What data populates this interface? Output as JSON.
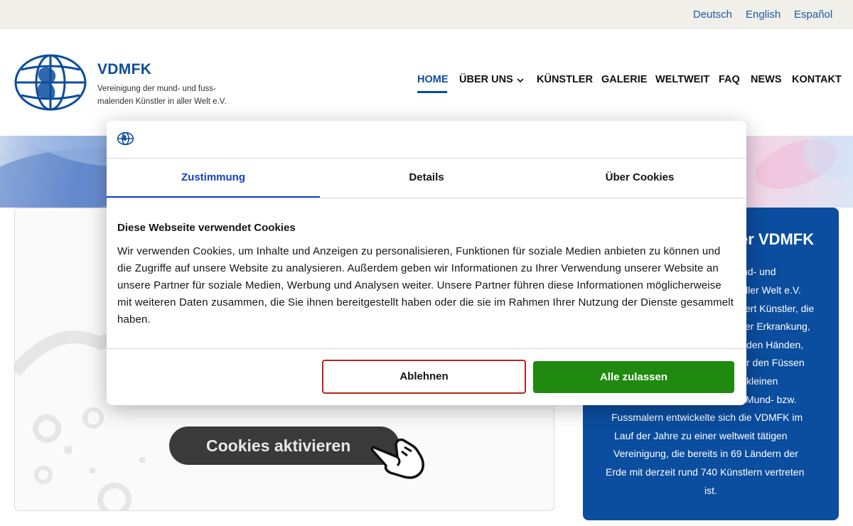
{
  "languages": [
    "Deutsch",
    "English",
    "Español"
  ],
  "brand": {
    "name": "VDMFK",
    "tagline_line1": "Vereinigung der mund- und fuss-",
    "tagline_line2": "malenden Künstler in aller Welt e.V."
  },
  "nav": {
    "items": [
      "HOME",
      "ÜBER UNS",
      "KÜNSTLER",
      "GALERIE",
      "WELTWEIT",
      "FAQ",
      "NEWS",
      "KONTAKT"
    ],
    "active": "HOME"
  },
  "content": {
    "cookie_placeholder_button": "Cookies aktivieren"
  },
  "sidebar": {
    "title": "er VDMFK",
    "lines": [
      "nd- und",
      "ller Welt e.V.",
      "ert Künstler, die",
      "er Erkrankung,",
      "den Händen,",
      "r den Füssen",
      "kleinen",
      "Mund- bzw.",
      "Fussmalern entwickelte sich die VDMFK im",
      "Lauf der Jahre zu einer weltweit tätigen",
      "Vereinigung, die bereits in 69 Ländern der",
      "Erde mit derzeit rund 740 Künstlern vertreten",
      "ist."
    ]
  },
  "cookie_dialog": {
    "tabs": [
      "Zustimmung",
      "Details",
      "Über Cookies"
    ],
    "active_tab": "Zustimmung",
    "heading": "Diese Webseite verwendet Cookies",
    "body": "Wir verwenden Cookies, um Inhalte und Anzeigen zu personalisieren, Funktionen für soziale Medien anbieten zu können und die Zugriffe auf unsere Website zu analysieren. Außerdem geben wir Informationen zu Ihrer Verwendung unserer Website an unsere Partner für soziale Medien, Werbung und Analysen weiter. Unsere Partner führen diese Informationen möglicherweise mit weiteren Daten zusammen, die Sie ihnen bereitgestellt haben oder die sie im Rahmen Ihrer Nutzung der Dienste gesammelt haben.",
    "decline_label": "Ablehnen",
    "accept_label": "Alle zulassen"
  },
  "colors": {
    "brand_blue": "#0b4d9e",
    "accept_green": "#1f8a0f",
    "decline_border": "#b3261e",
    "tab_active": "#1741c4"
  },
  "icons": {
    "logo": "globe-logo-icon",
    "dropdown": "chevron-down-icon",
    "hand": "pointing-hand-icon"
  }
}
